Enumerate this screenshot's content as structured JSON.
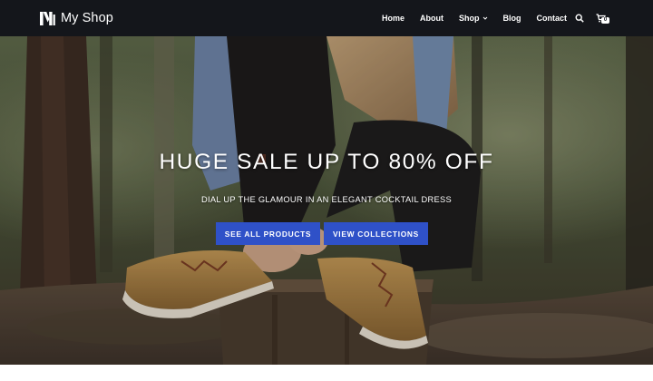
{
  "header": {
    "brand": "My Shop",
    "logo_icon": "shop-logo-icon",
    "nav": [
      {
        "label": "Home"
      },
      {
        "label": "About"
      },
      {
        "label": "Shop",
        "has_dropdown": true
      },
      {
        "label": "Blog"
      },
      {
        "label": "Contact"
      }
    ],
    "search_icon": "search-icon",
    "cart_icon": "cart-icon",
    "cart_count": "0",
    "background": "#14161b"
  },
  "hero": {
    "title": "HUGE SALE UP TO 80% OFF",
    "subtitle": "DIAL UP THE GLAMOUR IN AN ELEGANT COCKTAIL DRESS",
    "buttons": [
      {
        "label": "SEE ALL PRODUCTS"
      },
      {
        "label": "VIEW COLLECTIONS"
      }
    ],
    "button_color": "#2f51c8",
    "image": "woman-sitting-on-tree-stump-tying-boots-in-forest"
  }
}
